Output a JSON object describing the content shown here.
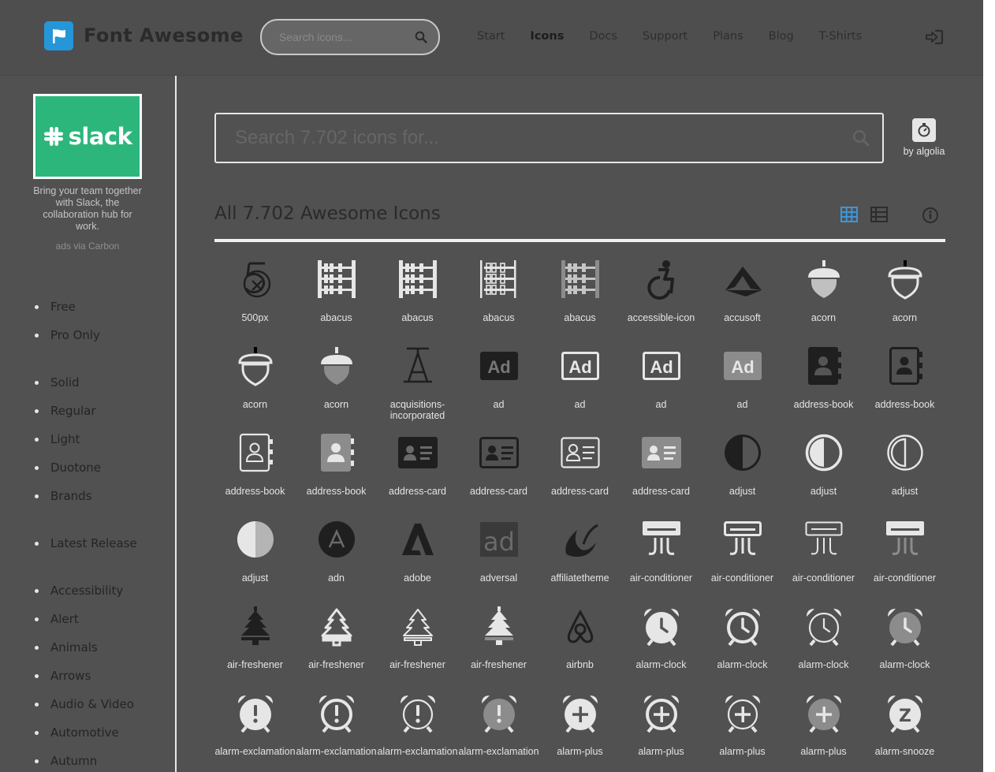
{
  "nav": {
    "brand": "Font Awesome",
    "search_placeholder": "Search icons...",
    "links": [
      {
        "label": "Start"
      },
      {
        "label": "Icons",
        "active": true
      },
      {
        "label": "Docs"
      },
      {
        "label": "Support"
      },
      {
        "label": "Plans"
      },
      {
        "label": "Blog"
      },
      {
        "label": "T-Shirts"
      }
    ],
    "signin_icon": "sign-in-icon"
  },
  "ad": {
    "brand": "slack",
    "text": "Bring your team together with Slack, the collaboration hub for work.",
    "via": "ads via Carbon"
  },
  "sidebar": {
    "filters": [
      {
        "label": "Free"
      },
      {
        "label": "Pro Only"
      },
      {
        "label": "Solid"
      },
      {
        "label": "Regular"
      },
      {
        "label": "Light"
      },
      {
        "label": "Duotone"
      },
      {
        "label": "Brands"
      },
      {
        "label": "Latest Release"
      },
      {
        "label": "Accessibility"
      },
      {
        "label": "Alert"
      },
      {
        "label": "Animals"
      },
      {
        "label": "Arrows"
      },
      {
        "label": "Audio & Video"
      },
      {
        "label": "Automotive"
      },
      {
        "label": "Autumn"
      }
    ]
  },
  "main": {
    "search_placeholder": "Search 7.702 icons for...",
    "algolia_label": "by algolia",
    "section_title": "All 7.702 Awesome Icons",
    "icons": [
      {
        "name": "500px"
      },
      {
        "name": "abacus"
      },
      {
        "name": "abacus"
      },
      {
        "name": "abacus"
      },
      {
        "name": "abacus"
      },
      {
        "name": "accessible-icon"
      },
      {
        "name": "accusoft"
      },
      {
        "name": "acorn"
      },
      {
        "name": "acorn"
      },
      {
        "name": "acorn"
      },
      {
        "name": "acorn"
      },
      {
        "name": "acquisitions-incorporated"
      },
      {
        "name": "ad"
      },
      {
        "name": "ad"
      },
      {
        "name": "ad"
      },
      {
        "name": "ad"
      },
      {
        "name": "address-book"
      },
      {
        "name": "address-book"
      },
      {
        "name": "address-book"
      },
      {
        "name": "address-book"
      },
      {
        "name": "address-card"
      },
      {
        "name": "address-card"
      },
      {
        "name": "address-card"
      },
      {
        "name": "address-card"
      },
      {
        "name": "adjust"
      },
      {
        "name": "adjust"
      },
      {
        "name": "adjust"
      },
      {
        "name": "adjust"
      },
      {
        "name": "adn"
      },
      {
        "name": "adobe"
      },
      {
        "name": "adversal"
      },
      {
        "name": "affiliatetheme"
      },
      {
        "name": "air-conditioner"
      },
      {
        "name": "air-conditioner"
      },
      {
        "name": "air-conditioner"
      },
      {
        "name": "air-conditioner"
      },
      {
        "name": "air-freshener"
      },
      {
        "name": "air-freshener"
      },
      {
        "name": "air-freshener"
      },
      {
        "name": "air-freshener"
      },
      {
        "name": "airbnb"
      },
      {
        "name": "alarm-clock"
      },
      {
        "name": "alarm-clock"
      },
      {
        "name": "alarm-clock"
      },
      {
        "name": "alarm-clock"
      },
      {
        "name": "alarm-exclamation"
      },
      {
        "name": "alarm-exclamation"
      },
      {
        "name": "alarm-exclamation"
      },
      {
        "name": "alarm-exclamation"
      },
      {
        "name": "alarm-plus"
      },
      {
        "name": "alarm-plus"
      },
      {
        "name": "alarm-plus"
      },
      {
        "name": "alarm-plus"
      },
      {
        "name": "alarm-snooze"
      }
    ]
  }
}
